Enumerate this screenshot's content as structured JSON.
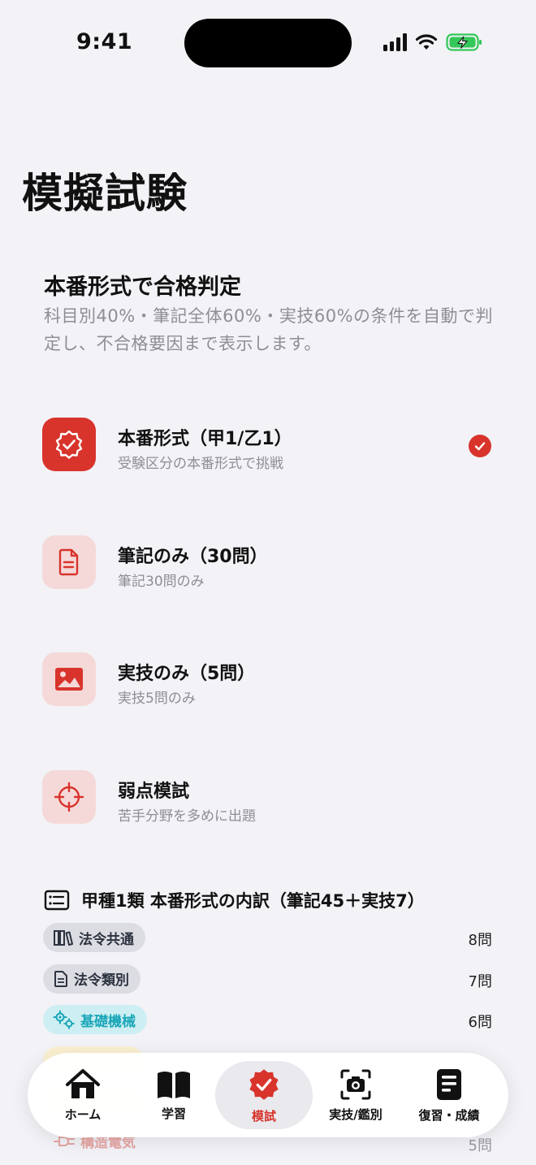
{
  "status": {
    "time": "9:41"
  },
  "page": {
    "title": "模擬試験"
  },
  "intro": {
    "title": "本番形式で合格判定",
    "description": "科目別40%・筆記全体60%・実技60%の条件を自動で判定し、不合格要因まで表示します。"
  },
  "modes": [
    {
      "label": "本番形式（甲1/乙1）",
      "sub": "受験区分の本番形式で挑戦",
      "icon": "badge-check-icon",
      "selected": true
    },
    {
      "label": "筆記のみ（30問）",
      "sub": "筆記30問のみ",
      "icon": "document-icon",
      "selected": false
    },
    {
      "label": "実技のみ（5問）",
      "sub": "実技5問のみ",
      "icon": "image-icon",
      "selected": false
    },
    {
      "label": "弱点模試",
      "sub": "苦手分野を多めに出題",
      "icon": "crosshair-icon",
      "selected": false
    }
  ],
  "breakdown": {
    "title": "甲種1類 本番形式の内訳（筆記45＋実技7）",
    "rows": [
      {
        "label": "法令共通",
        "count": "8問",
        "icon": "library-icon",
        "bg": "#dcdde3",
        "fg": "#2c3340"
      },
      {
        "label": "法令類別",
        "count": "7問",
        "icon": "document-icon",
        "bg": "#dcdde3",
        "fg": "#2c3340"
      },
      {
        "label": "基礎機械",
        "count": "6問",
        "icon": "gears-icon",
        "bg": "#cdeef2",
        "fg": "#19a6b8"
      },
      {
        "label": "",
        "count": "",
        "icon": "",
        "bg": "#fbf1d2",
        "fg": "#c99a1a"
      },
      {
        "label": "",
        "count": "",
        "icon": "",
        "bg": "#fde8d6",
        "fg": "#e07b2a"
      },
      {
        "label": "構造電気",
        "count": "5問",
        "icon": "plug-icon",
        "bg": "#fbdedd",
        "fg": "#d8342c"
      }
    ]
  },
  "tabs": [
    {
      "label": "ホーム",
      "icon": "home-icon",
      "active": false
    },
    {
      "label": "学習",
      "icon": "book-icon",
      "active": false
    },
    {
      "label": "模試",
      "icon": "badge-check-icon",
      "active": true
    },
    {
      "label": "実技/鑑別",
      "icon": "camera-scan-icon",
      "active": false
    },
    {
      "label": "復習・成績",
      "icon": "report-icon",
      "active": false
    }
  ],
  "colors": {
    "accent": "#d8342c",
    "background": "#f2f2f7",
    "muted": "#8e8e93"
  }
}
